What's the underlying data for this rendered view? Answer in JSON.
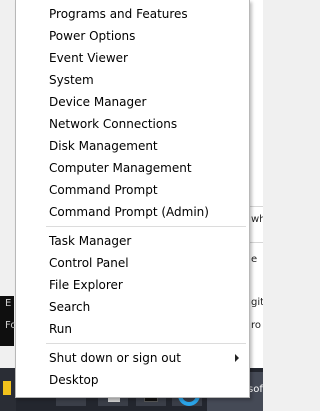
{
  "menu": {
    "groups": [
      [
        {
          "label": "Programs and Features"
        },
        {
          "label": "Power Options"
        },
        {
          "label": "Event Viewer"
        },
        {
          "label": "System"
        },
        {
          "label": "Device Manager"
        },
        {
          "label": "Network Connections"
        },
        {
          "label": "Disk Management"
        },
        {
          "label": "Computer Management"
        },
        {
          "label": "Command Prompt"
        },
        {
          "label": "Command Prompt (Admin)"
        }
      ],
      [
        {
          "label": "Task Manager"
        },
        {
          "label": "Control Panel"
        },
        {
          "label": "File Explorer"
        },
        {
          "label": "Search"
        },
        {
          "label": "Run"
        }
      ],
      [
        {
          "label": "Shut down or sign out",
          "has_submenu": true
        },
        {
          "label": "Desktop"
        }
      ]
    ]
  },
  "background": {
    "right_fragments": [
      "wh",
      "e",
      "gita",
      "ro"
    ],
    "left_fragments": [
      "E",
      "Fo"
    ],
    "taskbar_right_label": "rosoft"
  },
  "colors": {
    "menu_bg": "#ffffff",
    "menu_text": "#000000",
    "separator": "#dcdcdc",
    "taskbar": "#23262e",
    "start_accent": "#f2c21c",
    "ie_blue": "#2aa4e8"
  }
}
